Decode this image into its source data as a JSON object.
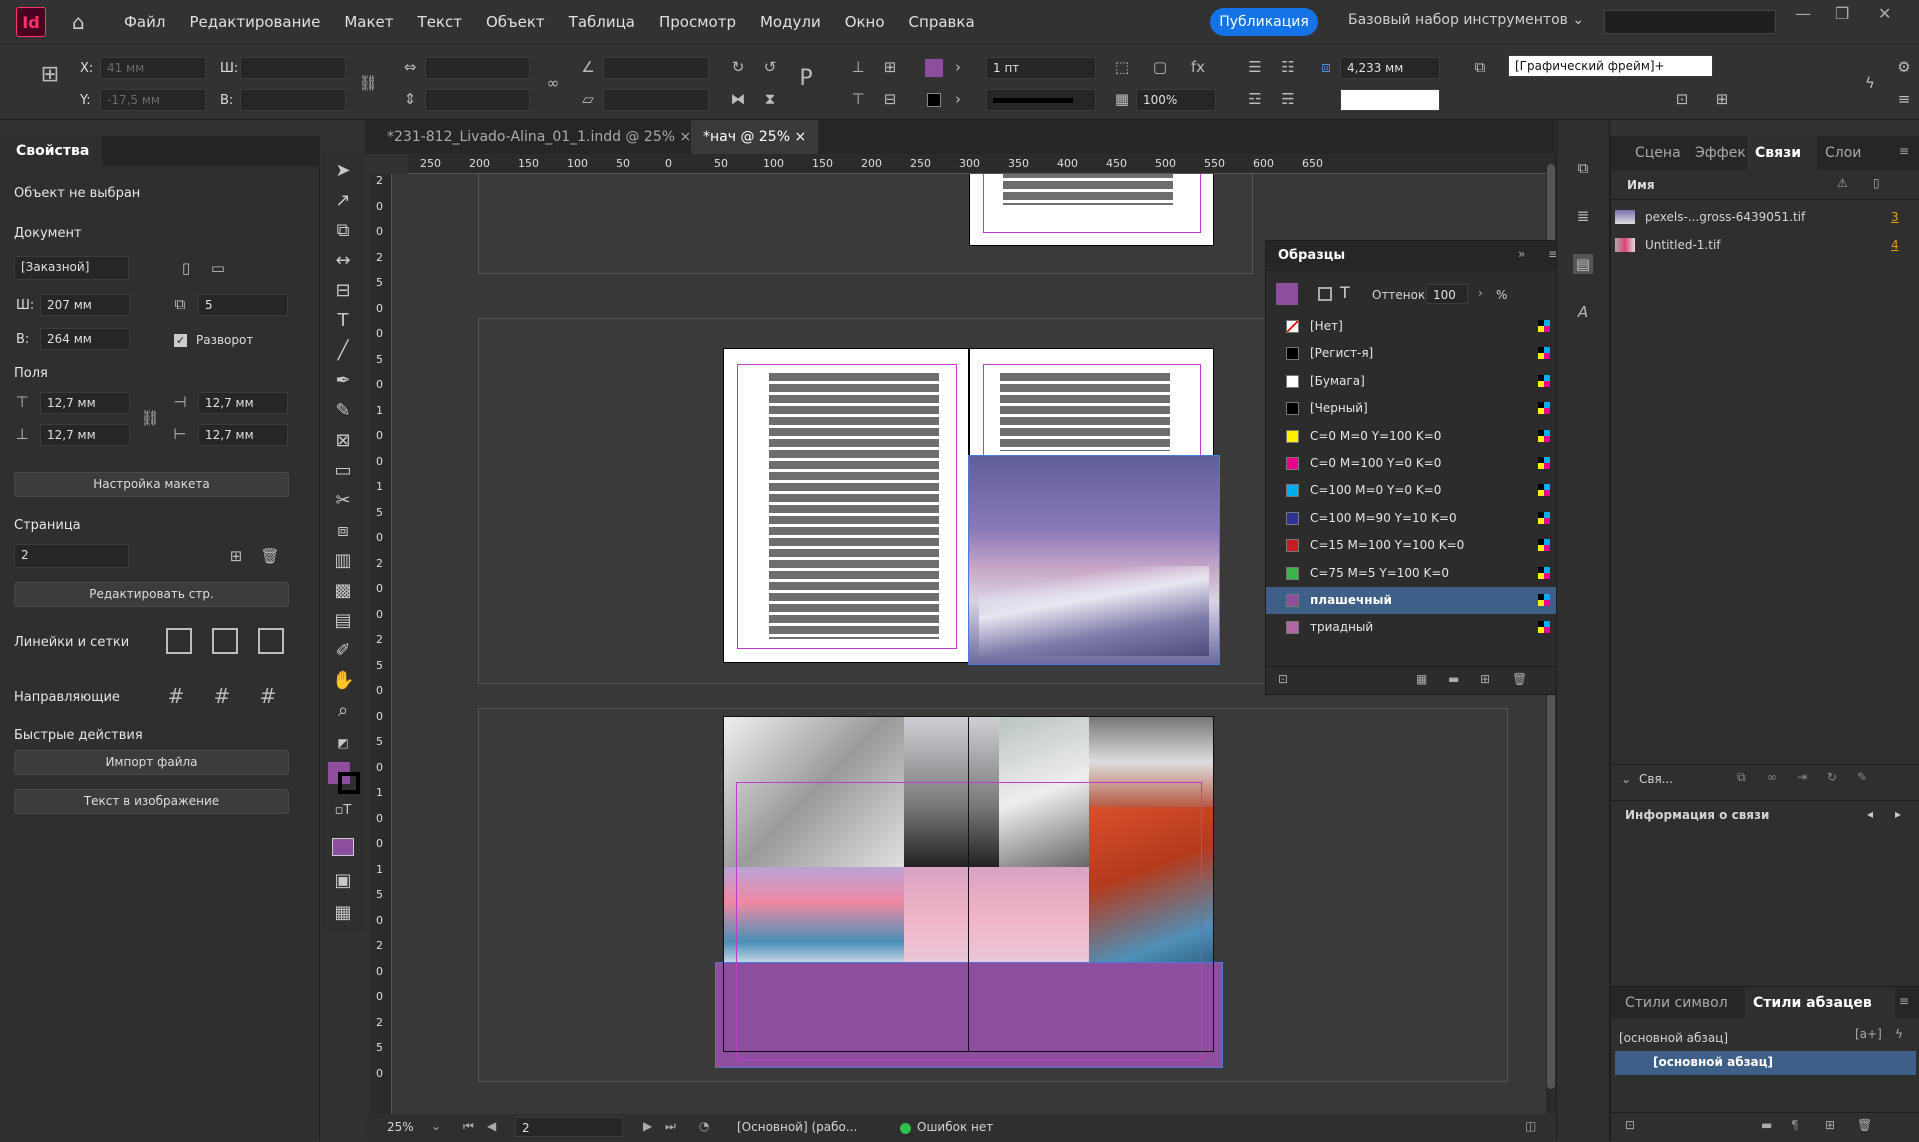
{
  "app": {
    "logo": "Id",
    "publish": "Публикация",
    "workspace": "Базовый набор инструментов ⌄"
  },
  "menu": [
    "Файл",
    "Редактирование",
    "Макет",
    "Текст",
    "Объект",
    "Таблица",
    "Просмотр",
    "Модули",
    "Окно",
    "Справка"
  ],
  "control": {
    "x_label": "X:",
    "x_value": "41 мм",
    "y_label": "Y:",
    "y_value": "-17,5 мм",
    "w_label": "Ш:",
    "h_label": "В:",
    "stroke_weight": "1 пт",
    "stroke_offset": "4,233 мм",
    "opacity": "100%",
    "frame_style": "[Графический фрейм]+"
  },
  "tabs": [
    {
      "label": "*231-812_Livado-Alina_01_1.indd @ 25%",
      "close": "×"
    },
    {
      "label": "*нач @ 25%",
      "close": "×"
    }
  ],
  "ruler_h": [
    "250",
    "200",
    "150",
    "100",
    "50",
    "0",
    "50",
    "100",
    "150",
    "200",
    "250",
    "300",
    "350",
    "400",
    "450",
    "500",
    "550",
    "600",
    "650"
  ],
  "ruler_v": [
    "2",
    "0",
    "0",
    "2",
    "5",
    "0",
    "0",
    "5",
    "0",
    "1",
    "0",
    "0",
    "1",
    "5",
    "0",
    "2",
    "0",
    "0",
    "2",
    "5",
    "0",
    "0",
    "5",
    "0",
    "1",
    "0",
    "0",
    "1",
    "5",
    "0",
    "2",
    "0",
    "0",
    "2",
    "5",
    "0"
  ],
  "props": {
    "title": "Свойства",
    "no_selection": "Объект не выбран",
    "document": "Документ",
    "preset": "[Заказной]",
    "w_label": "Ш:",
    "w_value": "207 мм",
    "h_label": "В:",
    "h_value": "264 мм",
    "pages": "5",
    "spread_label": "Разворот",
    "margins": "Поля",
    "m_top": "12,7 мм",
    "m_bottom": "12,7 мм",
    "m_left": "12,7 мм",
    "m_right": "12,7 мм",
    "layout_btn": "Настройка макета",
    "page_label": "Страница",
    "page_value": "2",
    "edit_page_btn": "Редактировать стр.",
    "rulers_grids": "Линейки и сетки",
    "guides": "Направляющие",
    "quick_actions": "Быстрые действия",
    "import_btn": "Импорт файла",
    "text_img_btn": "Текст в изображение"
  },
  "swatches": {
    "title": "Образцы",
    "tint_label": "Оттенок:",
    "tint_value": "100",
    "percent": "%",
    "items": [
      {
        "name": "[Нет]",
        "color": "none"
      },
      {
        "name": "[Регист-я]",
        "color": "#000000"
      },
      {
        "name": "[Бумага]",
        "color": "#ffffff"
      },
      {
        "name": "[Черный]",
        "color": "#000000"
      },
      {
        "name": "C=0 M=0 Y=100 K=0",
        "color": "#fff200"
      },
      {
        "name": "C=0 M=100 Y=0 K=0",
        "color": "#ec008c"
      },
      {
        "name": "C=100 M=0 Y=0 K=0",
        "color": "#00aeef"
      },
      {
        "name": "C=100 M=90 Y=10 K=0",
        "color": "#2e3192"
      },
      {
        "name": "C=15 M=100 Y=100 K=0",
        "color": "#c41e24"
      },
      {
        "name": "C=75 M=5 Y=100 K=0",
        "color": "#39b54a"
      },
      {
        "name": "плашечный",
        "color": "#8e4e9e",
        "selected": true
      },
      {
        "name": "триадный",
        "color": "#b266a6"
      }
    ]
  },
  "links": {
    "tabs": [
      "Сцена",
      "Эффек",
      "Связи",
      "Слои"
    ],
    "name_header": "Имя",
    "items": [
      {
        "name": "pexels-...gross-6439051.tif",
        "page": "3"
      },
      {
        "name": "Untitled-1.tif",
        "page": "4"
      }
    ],
    "found": "Свя...",
    "info": "Информация о связи"
  },
  "styles": {
    "tabs": [
      "Стили символ",
      "Стили абзацев"
    ],
    "current": "[основной абзац]",
    "selected": "[основной абзац]"
  },
  "status": {
    "zoom": "25%",
    "page": "2",
    "profile": "[Основной] (рабо...",
    "errors": "Ошибок нет"
  },
  "colors": {
    "accent": "#1473e6",
    "fill": "#8e4e9e",
    "selection": "#3e5f87"
  }
}
